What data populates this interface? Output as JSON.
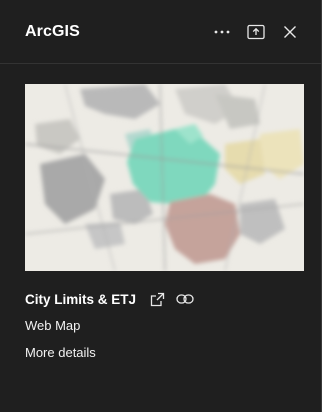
{
  "header": {
    "title": "ArcGIS",
    "icons": [
      "more-horizontal-icon",
      "pop-out-icon",
      "close-icon"
    ]
  },
  "item": {
    "title": "City Limits & ETJ",
    "type": "Web Map",
    "more_details": "More details",
    "icons": [
      "external-link-icon",
      "link-icon"
    ]
  },
  "colors": {
    "background": "#1f1f1f",
    "text": "#ffffff",
    "city_limits": "#7fd8be",
    "etj": "#c5a39b"
  }
}
